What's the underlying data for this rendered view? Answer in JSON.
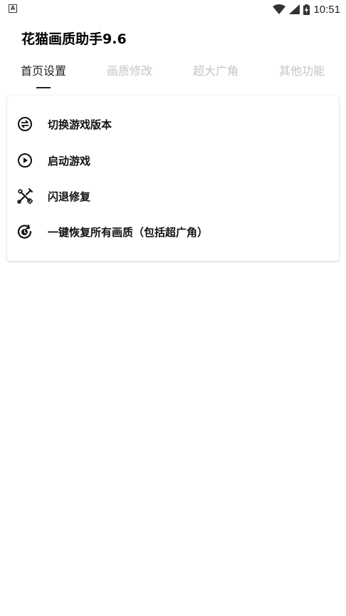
{
  "status_bar": {
    "time": "10:51",
    "left_icon": "android-a-icon",
    "icons": [
      "wifi-icon",
      "signal-icon",
      "battery-charging-icon"
    ]
  },
  "app": {
    "title": "花猫画质助手9.6"
  },
  "tabs": [
    {
      "label": "首页设置",
      "active": true
    },
    {
      "label": "画质修改",
      "active": false
    },
    {
      "label": "超大广角",
      "active": false
    },
    {
      "label": "其他功能",
      "active": false
    }
  ],
  "menu": [
    {
      "label": "切换游戏版本",
      "icon": "switch-icon"
    },
    {
      "label": "启动游戏",
      "icon": "play-icon"
    },
    {
      "label": "闪退修复",
      "icon": "tools-icon"
    },
    {
      "label": "一键恢复所有画质（包括超广角）",
      "icon": "restore-icon"
    }
  ],
  "colors": {
    "tab_active": "#222222",
    "tab_inactive": "#c4c4c4",
    "background": "#ffffff"
  }
}
